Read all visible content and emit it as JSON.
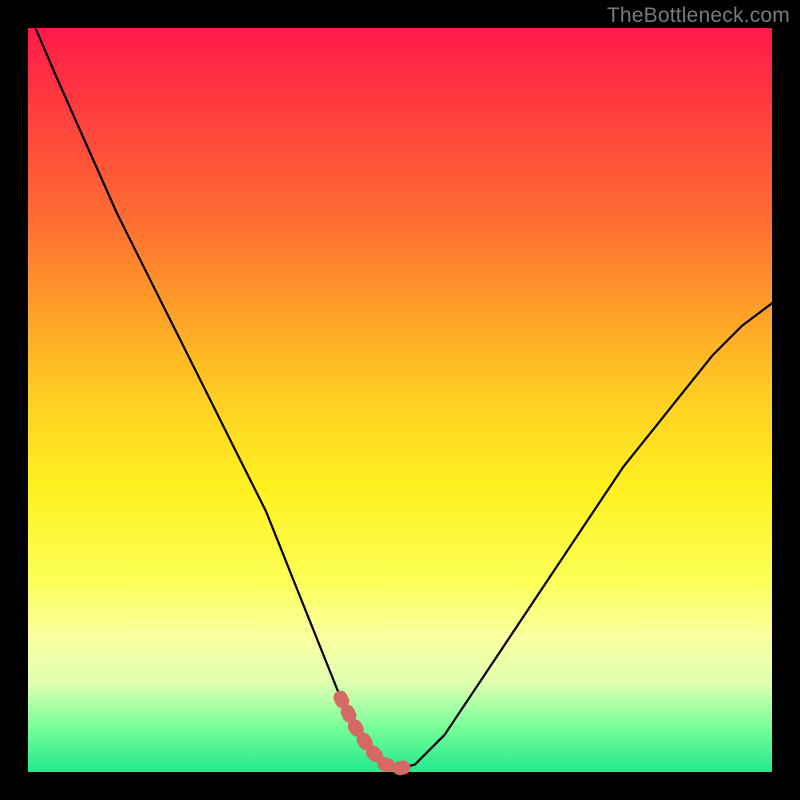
{
  "watermark": "TheBottleneck.com",
  "colors": {
    "background": "#000000",
    "curve": "#000000",
    "highlight": "#d46a63",
    "watermark": "#7a7a7a"
  },
  "chart_data": {
    "type": "line",
    "title": "",
    "xlabel": "",
    "ylabel": "",
    "xlim": [
      0,
      100
    ],
    "ylim": [
      0,
      100
    ],
    "grid": false,
    "legend": false,
    "series": [
      {
        "name": "bottleneck-curve",
        "x": [
          1,
          4,
          8,
          12,
          16,
          20,
          24,
          28,
          32,
          34,
          36,
          38,
          40,
          42,
          44,
          46,
          48,
          50,
          52,
          56,
          60,
          64,
          68,
          72,
          76,
          80,
          84,
          88,
          92,
          96,
          100
        ],
        "y": [
          100,
          93,
          84,
          75,
          67,
          59,
          51,
          43,
          35,
          30,
          25,
          20,
          15,
          10,
          6,
          3,
          1,
          0.5,
          1,
          5,
          11,
          17,
          23,
          29,
          35,
          41,
          46,
          51,
          56,
          60,
          63
        ]
      }
    ],
    "annotations": [
      {
        "name": "valley-highlight",
        "x_range": [
          42,
          52
        ],
        "y_range": [
          0,
          10
        ],
        "color": "#d46a63"
      }
    ]
  }
}
